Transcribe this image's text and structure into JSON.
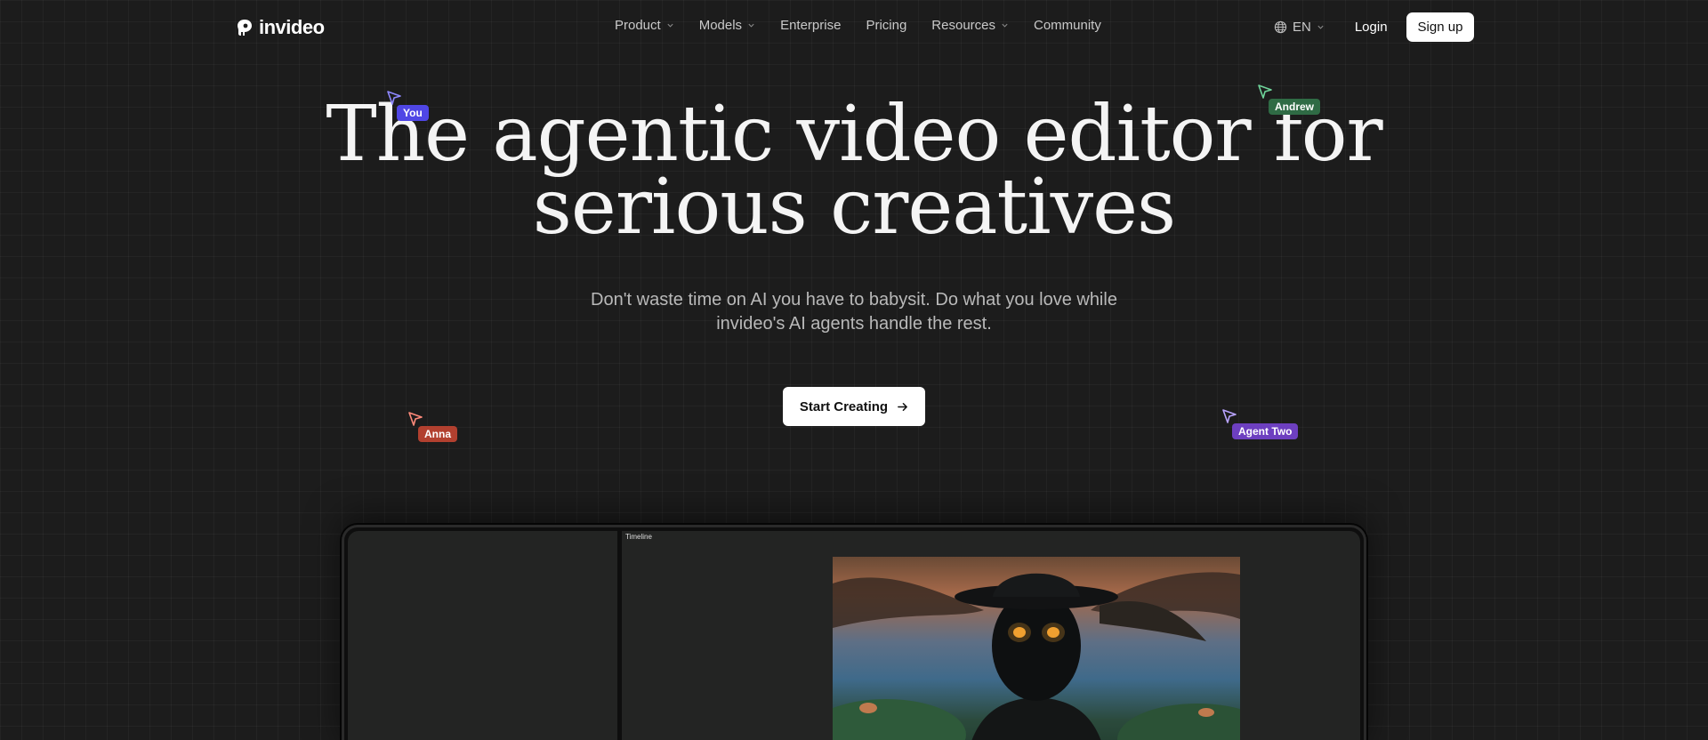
{
  "brand": {
    "name": "invideo"
  },
  "nav": {
    "links": [
      {
        "label": "Product",
        "has_dropdown": true
      },
      {
        "label": "Models",
        "has_dropdown": true
      },
      {
        "label": "Enterprise",
        "has_dropdown": false
      },
      {
        "label": "Pricing",
        "has_dropdown": false
      },
      {
        "label": "Resources",
        "has_dropdown": true
      },
      {
        "label": "Community",
        "has_dropdown": false
      }
    ],
    "language": "EN",
    "login": "Login",
    "signup": "Sign up"
  },
  "hero": {
    "headline_line1": "The agentic video editor for",
    "headline_line2": "serious creatives",
    "subtitle": "Don't waste time on AI you have to babysit. Do what you love while invideo's AI agents handle the rest.",
    "cta": "Start Creating"
  },
  "cursors": [
    {
      "name": "You",
      "color": "#4f46e5"
    },
    {
      "name": "Andrew",
      "color": "#2f6b45"
    },
    {
      "name": "Anna",
      "color": "#b2402f"
    },
    {
      "name": "Agent Two",
      "color": "#6d3fc0"
    }
  ],
  "preview": {
    "timeline_label": "Timeline"
  },
  "colors": {
    "background": "#1c1c1c",
    "text_muted": "#b9b9b9",
    "button_bg": "#ffffff"
  }
}
